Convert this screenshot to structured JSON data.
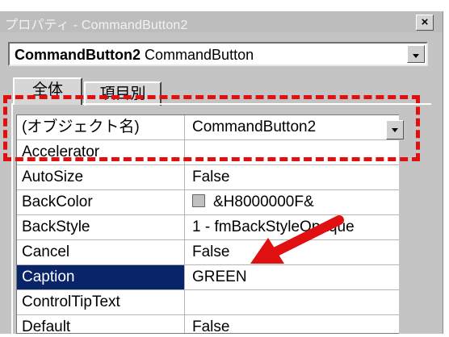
{
  "window": {
    "title": "プロパティ - CommandButton2"
  },
  "object_select": {
    "name": "CommandButton2",
    "type": "CommandButton"
  },
  "tabs": [
    {
      "label": "全体"
    },
    {
      "label": "項目別"
    }
  ],
  "properties": [
    {
      "name": "(オブジェクト名)",
      "value": "CommandButton2"
    },
    {
      "name": "Accelerator",
      "value": ""
    },
    {
      "name": "AutoSize",
      "value": "False"
    },
    {
      "name": "BackColor",
      "value": "&H8000000F&"
    },
    {
      "name": "BackStyle",
      "value": "1 - fmBackStyleOpaque"
    },
    {
      "name": "Cancel",
      "value": "False"
    },
    {
      "name": "Caption",
      "value": "GREEN"
    },
    {
      "name": "ControlTipText",
      "value": ""
    },
    {
      "name": "Default",
      "value": "False"
    }
  ],
  "selected_property": "Caption",
  "colors": {
    "selection": "#0a246a",
    "annotation": "#e01010",
    "swatch": "#c0c0c0"
  },
  "icons": {
    "close": "close-icon",
    "dropdown": "chevron-down-icon",
    "annotation": "red-arrow-icon"
  }
}
